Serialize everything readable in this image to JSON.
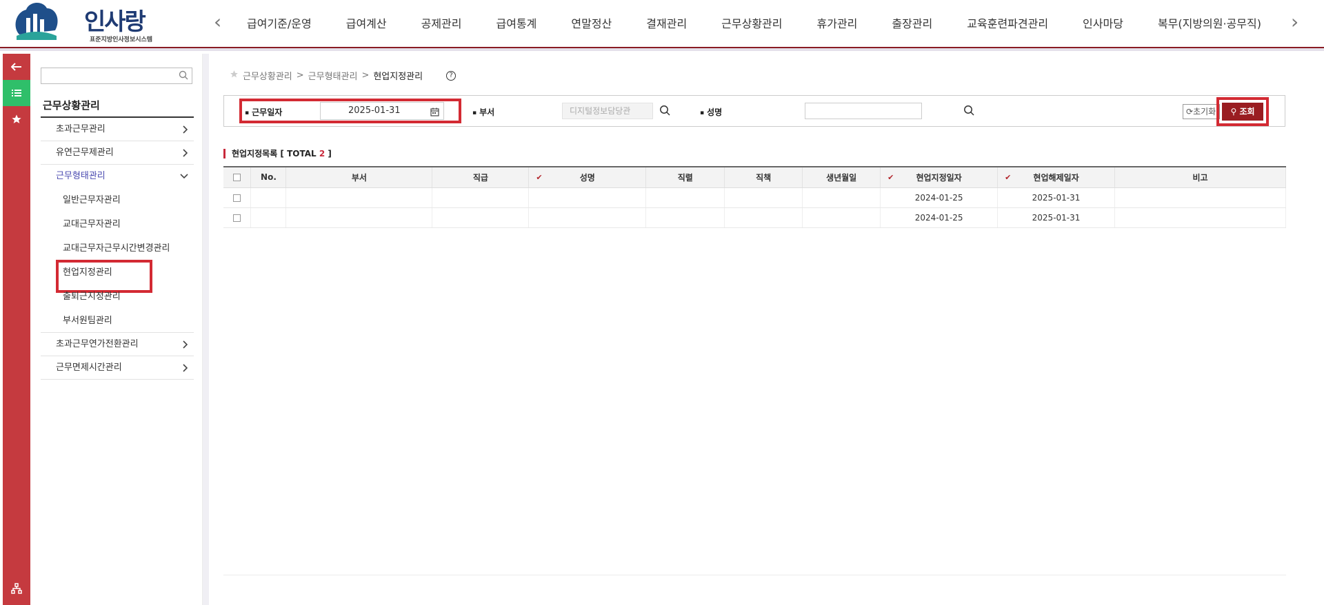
{
  "header": {
    "logo_text_main": "인사랑",
    "logo_subtitle": "표준지방인사정보시스템",
    "nav_items": [
      "급여기준/운영",
      "급여계산",
      "공제관리",
      "급여통계",
      "연말정산",
      "결재관리",
      "근무상황관리",
      "휴가관리",
      "출장관리",
      "교육훈련파견관리",
      "인사마당",
      "복무(지방의원·공무직)"
    ]
  },
  "sidebar": {
    "search_value": "",
    "title": "근무상황관리",
    "items": [
      {
        "label": "초과근무관리"
      },
      {
        "label": "유연근무제관리"
      },
      {
        "label": "근무형태관리",
        "open": true,
        "children": [
          "일반근무자관리",
          "교대근무자관리",
          "교대근무자근무시간변경관리",
          "현업지정관리",
          "출퇴근지정관리",
          "부서원팀관리"
        ]
      },
      {
        "label": "초과근무연가전환관리"
      },
      {
        "label": "근무면제시간관리"
      }
    ]
  },
  "breadcrumb": {
    "items": [
      "근무상황관리",
      "근무형태관리"
    ],
    "current": "현업지정관리",
    "separator": ">"
  },
  "search_form": {
    "work_date_label": "근무일자",
    "work_date_value": "2025-01-31",
    "dept_label": "부서",
    "dept_value": "디지털정보담당관",
    "name_label": "성명",
    "name_value": "",
    "reset_label": "초기화",
    "query_label": "조회"
  },
  "list": {
    "title_prefix": "현업지정목록 [ TOTAL ",
    "total": "2",
    "title_suffix": " ]",
    "columns": [
      "No.",
      "부서",
      "직급",
      "성명",
      "직렬",
      "직책",
      "생년월일",
      "현업지정일자",
      "현업해제일자",
      "비고"
    ],
    "rows": [
      {
        "no": "",
        "dept": "",
        "rank": "",
        "name": "",
        "series": "",
        "duty": "",
        "birth": "",
        "start": "2024-01-25",
        "end": "2025-01-31",
        "note": ""
      },
      {
        "no": "",
        "dept": "",
        "rank": "",
        "name": "",
        "series": "",
        "duty": "",
        "birth": "",
        "start": "2024-01-25",
        "end": "2025-01-31",
        "note": ""
      }
    ]
  },
  "colors": {
    "brand_red": "#c53a3f",
    "highlight_red": "#d32a33",
    "query_button": "#9a1d21",
    "active_green": "#2fbf6a"
  }
}
